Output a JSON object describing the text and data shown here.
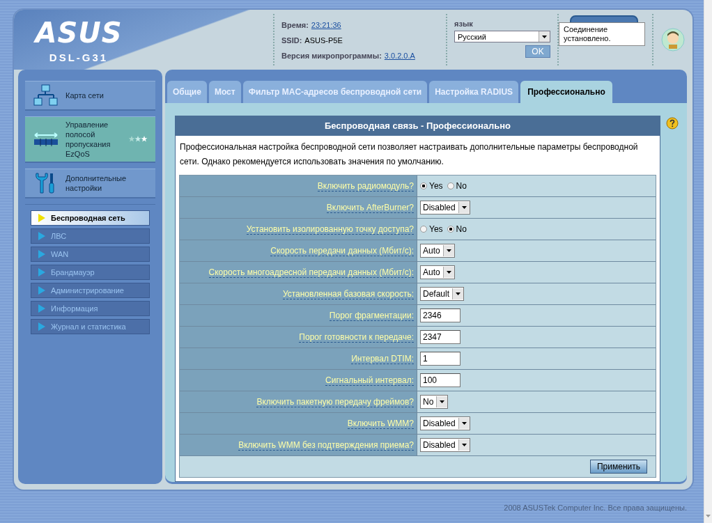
{
  "header": {
    "logo": "ASUS",
    "model": "DSL-G31",
    "time_label": "Время:",
    "time": "23:21:36",
    "ssid_label": "SSID:",
    "ssid": "ASUS-P5E",
    "firmware_label": "Версия микропрограммы:",
    "firmware": "3.0.2.0.A",
    "language_label": "язык",
    "language": "Русский",
    "ok_button": "OK",
    "status_tooltip": "Соединение установлено."
  },
  "sidebar": {
    "items": [
      {
        "kind": "map",
        "label": "Карта сети",
        "selected": false
      },
      {
        "kind": "qos",
        "label": "Управление полосой пропускания EzQoS",
        "selected": true
      },
      {
        "kind": "tools",
        "label": "Дополнительные настройки",
        "selected": false
      }
    ],
    "subitems": [
      {
        "label": "Беспроводная сеть",
        "selected": true
      },
      {
        "label": "ЛВС",
        "selected": false
      },
      {
        "label": "WAN",
        "selected": false
      },
      {
        "label": "Брандмауэр",
        "selected": false
      },
      {
        "label": "Администрирование",
        "selected": false
      },
      {
        "label": "Информация",
        "selected": false
      },
      {
        "label": "Журнал и статистика",
        "selected": false
      }
    ]
  },
  "tabs": [
    {
      "label": "Общие",
      "selected": false
    },
    {
      "label": "Мост",
      "selected": false
    },
    {
      "label": "Фильтр MAC-адресов беспроводной сети",
      "selected": false
    },
    {
      "label": "Настройка RADIUS",
      "selected": false
    },
    {
      "label": "Профессионально",
      "selected": true
    }
  ],
  "panel": {
    "title": "Беспроводная связь - Профессионально",
    "description": "Профессиональная настройка беспроводной сети позволяет настраивать дополнительные параметры беспроводной сети. Однако рекомендуется использовать значения по умолчанию.",
    "rows": [
      {
        "kind": "radio",
        "label": "Включить радиомодуль?",
        "options": [
          {
            "label": "Yes",
            "selected": true
          },
          {
            "label": "No",
            "selected": false
          }
        ]
      },
      {
        "kind": "select",
        "label": "Включить AfterBurner?",
        "value": "Disabled"
      },
      {
        "kind": "radio",
        "label": "Установить изолированную точку доступа?",
        "options": [
          {
            "label": "Yes",
            "selected": false
          },
          {
            "label": "No",
            "selected": true
          }
        ]
      },
      {
        "kind": "select",
        "label": "Скорость передачи данных (Мбит/с):",
        "value": "Auto"
      },
      {
        "kind": "select",
        "label": "Скорость многоадресной передачи данных (Мбит/с):",
        "value": "Auto"
      },
      {
        "kind": "select",
        "label": "Установленная базовая скорость:",
        "value": "Default"
      },
      {
        "kind": "text",
        "label": "Порог фрагментации:",
        "value": "2346"
      },
      {
        "kind": "text",
        "label": "Порог готовности к передаче:",
        "value": "2347"
      },
      {
        "kind": "text",
        "label": "Интервал DTIM:",
        "value": "1"
      },
      {
        "kind": "text",
        "label": "Сигнальный интервал:",
        "value": "100"
      },
      {
        "kind": "select",
        "label": "Включить пакетную передачу фреймов?",
        "value": "No"
      },
      {
        "kind": "select",
        "label": "Включить WMM?",
        "value": "Disabled"
      },
      {
        "kind": "select",
        "label": "Включить WMM без подтверждения приема?",
        "value": "Disabled"
      }
    ],
    "apply_button": "Применить"
  },
  "footer": "2008 ASUSTek Computer Inc. Все права защищены."
}
